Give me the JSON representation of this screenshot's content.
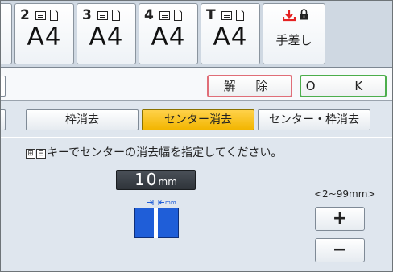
{
  "trays": [
    {
      "number": "",
      "size": "A4"
    },
    {
      "number": "2",
      "size": "A4"
    },
    {
      "number": "3",
      "size": "A4"
    },
    {
      "number": "4",
      "size": "A4"
    },
    {
      "number": "T",
      "size": "A4"
    }
  ],
  "bypass": {
    "label": "手差し"
  },
  "actions": {
    "clear": "解 除",
    "ok": "O K"
  },
  "modes": {
    "frame": "枠消去",
    "center": "センター消去",
    "both": "センター・枠消去",
    "selected": "center"
  },
  "instruction": "キーでセンターの消去幅を指定してください。",
  "key_glyphs": [
    "⊞",
    "⊟"
  ],
  "value": {
    "number": "10",
    "unit": "mm"
  },
  "range": "<2~99mm>",
  "stepper": {
    "plus": "+",
    "minus": "−"
  },
  "colors": {
    "selected_mode": "#f2b500",
    "clear_border": "#e06e78",
    "ok_border": "#4cae4c",
    "diagram_blue": "#1f5ed8",
    "bypass_red": "#e52222"
  }
}
